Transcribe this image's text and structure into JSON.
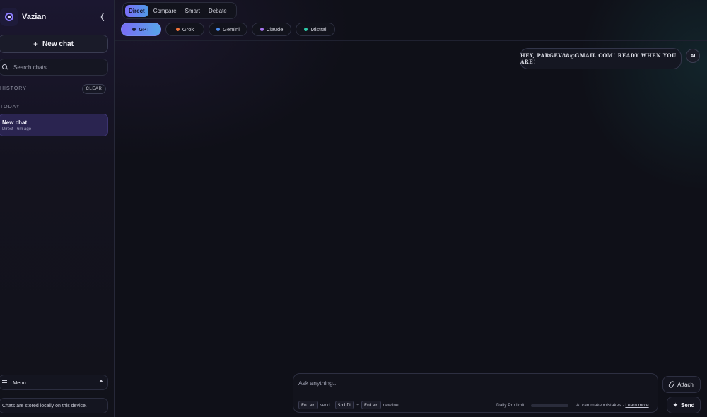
{
  "app": {
    "name": "Vazian",
    "collapse_glyph": "❬"
  },
  "sidebar": {
    "new_chat_label": "New chat",
    "search_placeholder": "Search chats",
    "history_label": "HISTORY",
    "clear_label": "CLEAR",
    "today_label": "TODAY",
    "chats": [
      {
        "title": "New chat",
        "meta": "Direct · 6m ago"
      }
    ],
    "menu_label": "Menu",
    "storage_note": "Chats are stored locally on this device."
  },
  "mode_tabs": [
    {
      "label": "Direct",
      "active": true
    },
    {
      "label": "Compare",
      "active": false
    },
    {
      "label": "Smart",
      "active": false
    },
    {
      "label": "Debate",
      "active": false
    }
  ],
  "models": [
    {
      "label": "GPT",
      "dot_color": "#1a1f3a",
      "active": true
    },
    {
      "label": "Grok",
      "dot_color": "#f2743a",
      "active": false
    },
    {
      "label": "Gemini",
      "dot_color": "#4d8ef0",
      "active": false
    },
    {
      "label": "Claude",
      "dot_color": "#a875f0",
      "active": false
    },
    {
      "label": "Mistral",
      "dot_color": "#2ec9a8",
      "active": false
    }
  ],
  "messages": [
    {
      "role": "assistant",
      "avatar": "AI",
      "text": "HEY, PARGEV88@GMAIL.COM! READY WHEN YOU ARE!"
    }
  ],
  "composer": {
    "placeholder": "Ask anything...",
    "hint_enter": "Enter",
    "hint_send": "send ·",
    "hint_shift": "Shift",
    "hint_plus": "+",
    "hint_enter2": "Enter",
    "hint_newline": "newline",
    "limit_label": "Daily Pro limit",
    "limit_fraction": 0,
    "disclaimer": "AI can make mistakes ·",
    "learn_more": "Learn more",
    "attach_label": "Attach",
    "send_label": "Send"
  },
  "colors": {
    "accent_start": "#7b6ef6",
    "accent_end": "#4f9be6",
    "background": "#0f1018"
  },
  "icons": [
    "orbit-logo-icon",
    "plus-icon",
    "search-icon",
    "hamburger-icon",
    "caret-up-icon",
    "paperclip-icon",
    "sparkle-send-icon"
  ]
}
